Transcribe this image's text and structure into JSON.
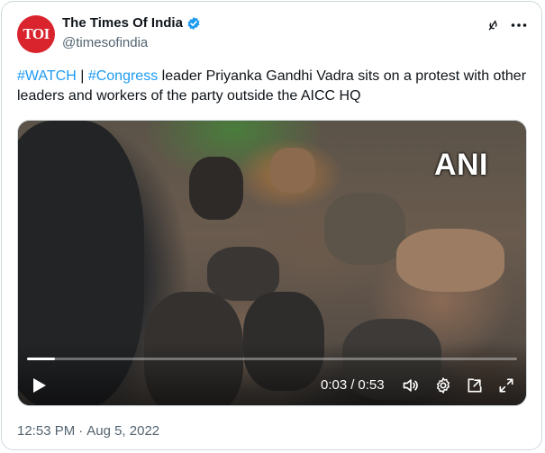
{
  "account": {
    "display_name": "The Times Of India",
    "handle": "@timesofindia",
    "avatar_text": "TOI",
    "verified": true
  },
  "tweet": {
    "hashtag_watch": "#WATCH",
    "separator": " | ",
    "hashtag_congress": "#Congress",
    "body": " leader Priyanka Gandhi Vadra sits on a protest with other leaders and workers of the party outside the AICC HQ"
  },
  "video": {
    "watermark": "ANI",
    "current_time": "0:03",
    "time_separator": "/",
    "duration": "0:53",
    "progress_fraction": 0.057
  },
  "meta": {
    "time": "12:53 PM",
    "dot": "·",
    "date": "Aug 5, 2022"
  },
  "colors": {
    "accent": "#1d9bf0",
    "avatar_bg": "#d9232d",
    "text_secondary": "#536471"
  },
  "icons": {
    "verified": "verified-badge-icon",
    "grok": "grok-icon",
    "more": "more-icon",
    "play": "play-icon",
    "volume": "volume-icon",
    "settings": "settings-icon",
    "popout": "popout-icon",
    "fullscreen": "fullscreen-icon"
  }
}
